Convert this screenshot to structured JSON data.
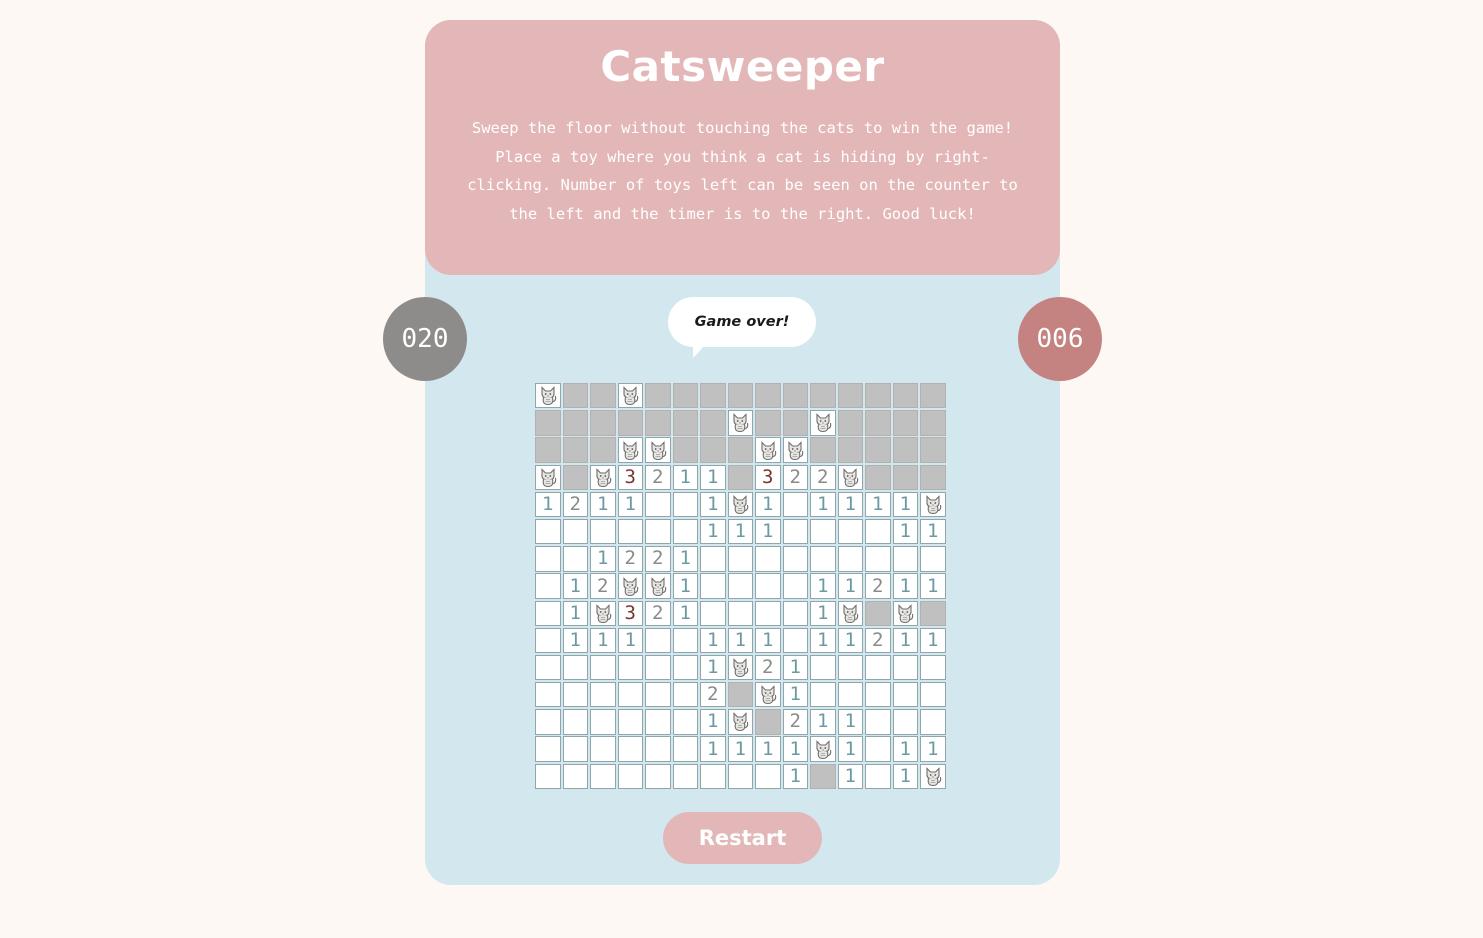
{
  "header": {
    "title": "Catsweeper",
    "description": "Sweep the floor without touching the cats to win the game! Place a toy where you think a cat is hiding by right-clicking. Number of toys left can be seen on the counter to the left and the timer is to the right. Good luck!"
  },
  "status": {
    "toys_left": "020",
    "timer": "006",
    "message": "Game over!"
  },
  "controls": {
    "restart_label": "Restart"
  },
  "colors": {
    "page_background": "#fdf8f4",
    "card_background": "#d2e7ee",
    "header_background": "#e3b7b8",
    "counter_left": "#8d8c8a",
    "counter_right": "#c48381",
    "hidden_tile": "#c0c0c0",
    "number_1": "#6d9aa2",
    "number_2": "#8a8a86",
    "number_3": "#7a3530"
  },
  "board": {
    "cat_icon": "cat-icon",
    "legend": "H = unrevealed tile, C = cat, 0 = empty revealed tile, digits = adjacent cat count",
    "rows": [
      [
        "C",
        "H",
        "H",
        "C",
        "H",
        "H",
        "H",
        "H",
        "H",
        "H",
        "H",
        "H",
        "H",
        "H",
        "H"
      ],
      [
        "H",
        "H",
        "H",
        "H",
        "H",
        "H",
        "H",
        "C",
        "H",
        "H",
        "C",
        "H",
        "H",
        "H",
        "H"
      ],
      [
        "H",
        "H",
        "H",
        "C",
        "C",
        "H",
        "H",
        "H",
        "C",
        "C",
        "H",
        "H",
        "H",
        "H",
        "H"
      ],
      [
        "C",
        "H",
        "C",
        "3",
        "2",
        "1",
        "1",
        "H",
        "3",
        "2",
        "2",
        "C",
        "H",
        "H",
        "H"
      ],
      [
        "1",
        "2",
        "1",
        "1",
        "0",
        "0",
        "1",
        "C",
        "1",
        "0",
        "1",
        "1",
        "1",
        "1",
        "C"
      ],
      [
        "0",
        "0",
        "0",
        "0",
        "0",
        "0",
        "1",
        "1",
        "1",
        "0",
        "0",
        "0",
        "0",
        "1",
        "1"
      ],
      [
        "0",
        "0",
        "1",
        "2",
        "2",
        "1",
        "0",
        "0",
        "0",
        "0",
        "0",
        "0",
        "0",
        "0",
        "0"
      ],
      [
        "0",
        "1",
        "2",
        "C",
        "C",
        "1",
        "0",
        "0",
        "0",
        "0",
        "1",
        "1",
        "2",
        "1",
        "1"
      ],
      [
        "0",
        "1",
        "C",
        "3",
        "2",
        "1",
        "0",
        "0",
        "0",
        "0",
        "1",
        "C",
        "H",
        "C",
        "H"
      ],
      [
        "0",
        "1",
        "1",
        "1",
        "0",
        "0",
        "1",
        "1",
        "1",
        "0",
        "1",
        "1",
        "2",
        "1",
        "1"
      ],
      [
        "0",
        "0",
        "0",
        "0",
        "0",
        "0",
        "1",
        "C",
        "2",
        "1",
        "0",
        "0",
        "0",
        "0",
        "0"
      ],
      [
        "0",
        "0",
        "0",
        "0",
        "0",
        "0",
        "2",
        "H",
        "C",
        "1",
        "0",
        "0",
        "0",
        "0",
        "0"
      ],
      [
        "0",
        "0",
        "0",
        "0",
        "0",
        "0",
        "1",
        "C",
        "H",
        "2",
        "1",
        "1",
        "0",
        "0",
        "0"
      ],
      [
        "0",
        "0",
        "0",
        "0",
        "0",
        "0",
        "1",
        "1",
        "1",
        "1",
        "C",
        "1",
        "0",
        "1",
        "1"
      ],
      [
        "0",
        "0",
        "0",
        "0",
        "0",
        "0",
        "0",
        "0",
        "0",
        "1",
        "H",
        "1",
        "0",
        "1",
        "C"
      ]
    ]
  }
}
